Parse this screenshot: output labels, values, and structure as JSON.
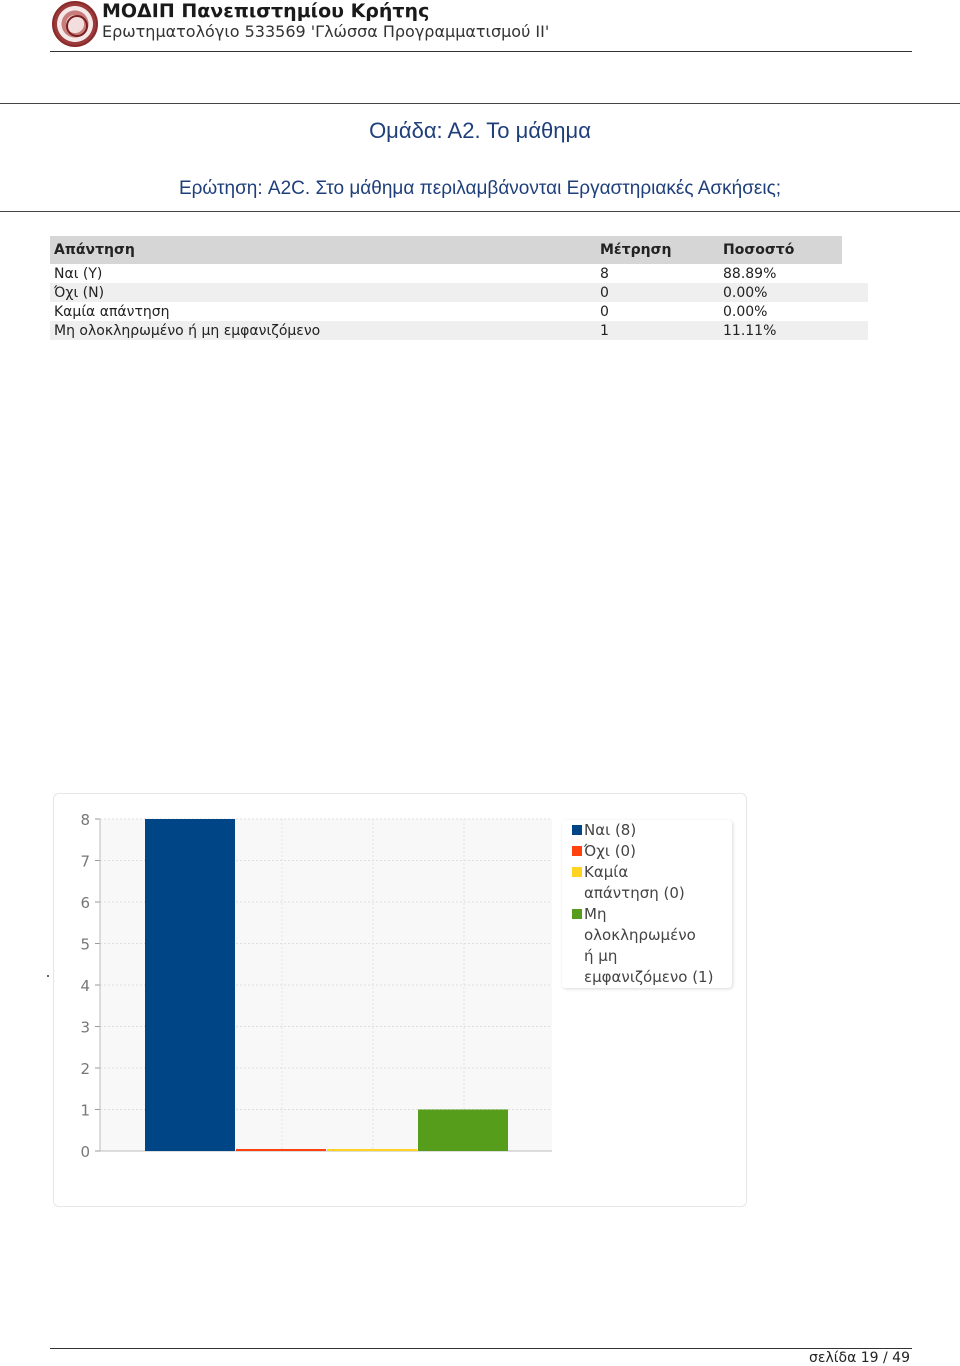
{
  "header": {
    "title": "ΜΟΔΙΠ Πανεπιστημίου Κρήτης",
    "subtitle": "Ερωτηματολόγιο 533569 'Γλώσσα Προγραμματισμού ΙΙ'"
  },
  "group_title": "Ομάδα: Α2. Το μάθημα",
  "question": "Ερώτηση: A2C. Στο μάθημα περιλαμβάνονται Εργαστηριακές Ασκήσεις;",
  "table": {
    "headers": [
      "Απάντηση",
      "Μέτρηση",
      "Ποσοστό"
    ],
    "rows": [
      [
        "Ναι (Y)",
        "8",
        "88.89%"
      ],
      [
        "Όχι (N)",
        "0",
        "0.00%"
      ],
      [
        "Καμία απάντηση",
        "0",
        "0.00%"
      ],
      [
        "Μη ολοκληρωμένο ή μη εμφανιζόμενο",
        "1",
        "11.11%"
      ]
    ]
  },
  "chart_data": {
    "type": "bar",
    "categories": [
      "Ναι (8)",
      "Όχι (0)",
      "Καμία απάντηση (0)",
      "Μη ολοκληρωμένο ή μη εμφανιζόμενο (1)"
    ],
    "values": [
      8,
      0,
      0,
      1
    ],
    "colors": [
      "#004586",
      "#ff420e",
      "#ffd320",
      "#579d1c"
    ],
    "yticks": [
      "0",
      "1",
      "2",
      "3",
      "4",
      "5",
      "6",
      "7",
      "8"
    ],
    "ylim": [
      0,
      8
    ],
    "grid": true,
    "legend_position": "top-right",
    "legend": [
      {
        "lines": [
          "Ναι (8)"
        ],
        "color": "#004586"
      },
      {
        "lines": [
          "Όχι (0)"
        ],
        "color": "#ff420e"
      },
      {
        "lines": [
          "Καμία",
          "απάντηση (0)"
        ],
        "color": "#ffd320"
      },
      {
        "lines": [
          "Μη",
          "ολοκληρωμένο",
          "ή μη",
          "εμφανιζόμενο (1)"
        ],
        "color": "#579d1c"
      }
    ]
  },
  "footer": {
    "page": "σελίδα 19 / 49"
  }
}
